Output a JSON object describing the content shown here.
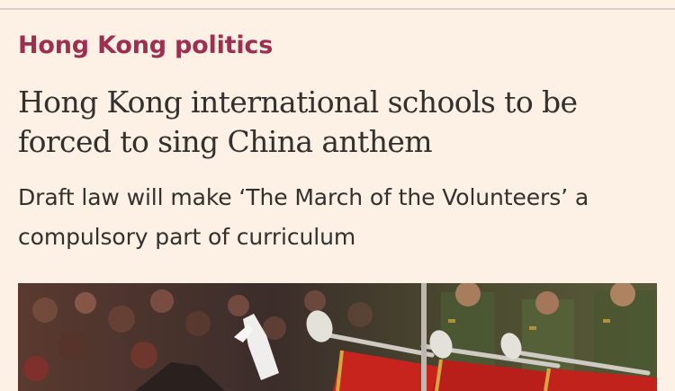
{
  "article": {
    "topic": "Hong Kong politics",
    "headline": "Hong Kong international schools to be forced to sing China anthem",
    "standfirst": "Draft law will make ‘The March of the Volunteers’ a compulsory part of curriculum"
  },
  "colors": {
    "background": "#fdf1e5",
    "topic": "#9e2f50",
    "text": "#33302e",
    "rule": "#d8cfc6"
  }
}
